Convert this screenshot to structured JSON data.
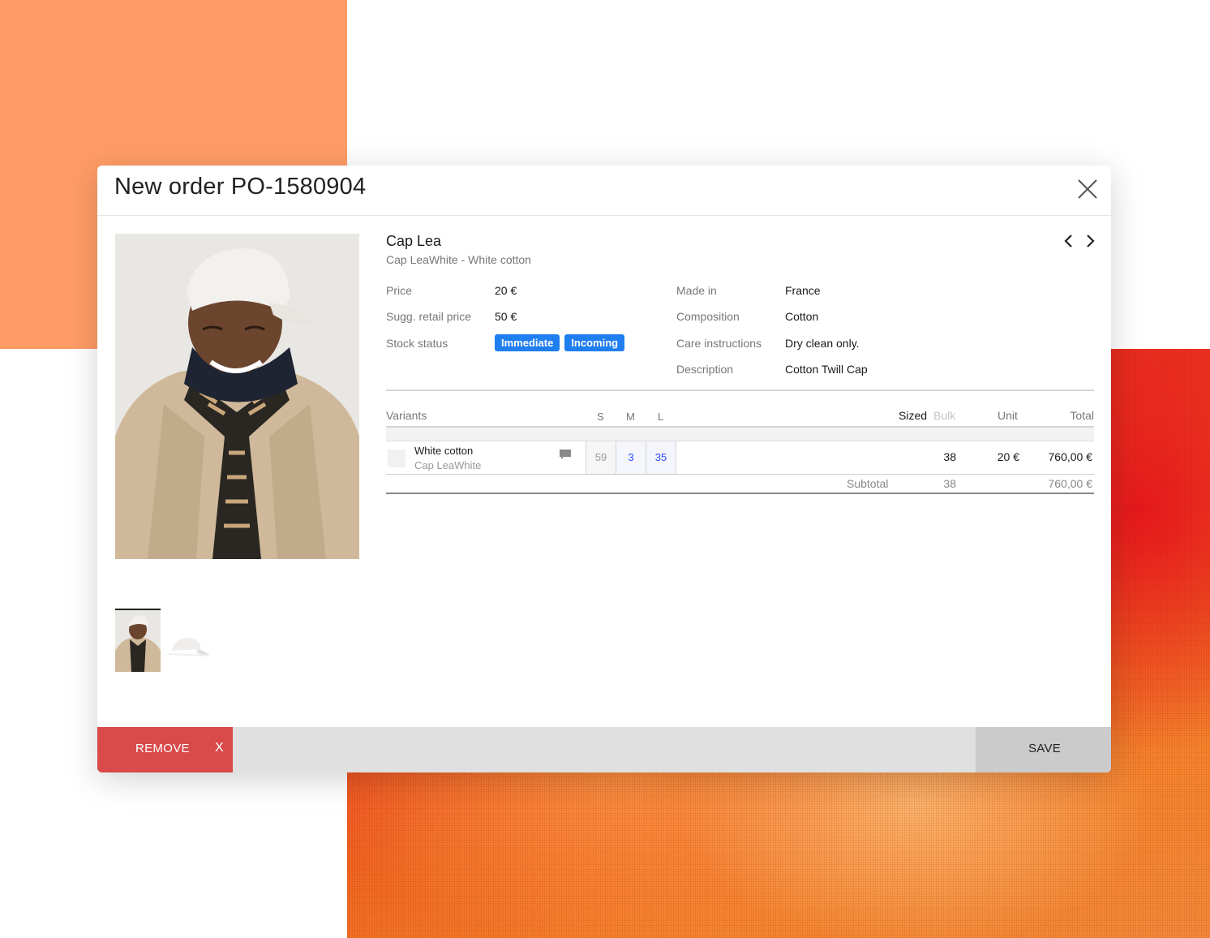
{
  "modal": {
    "title": "New order PO-1580904",
    "close_icon": "close-icon"
  },
  "product": {
    "name": "Cap Lea",
    "subtitle": "Cap LeaWhite - White cotton",
    "nav": {
      "prev_icon": "chevron-left-icon",
      "next_icon": "chevron-right-icon"
    }
  },
  "attributes_left": [
    {
      "label": "Price",
      "value": "20 €"
    },
    {
      "label": "Sugg. retail price",
      "value": "50 €"
    },
    {
      "label": "Stock status",
      "badges": [
        "Immediate",
        "Incoming"
      ]
    }
  ],
  "attributes_right": [
    {
      "label": "Made in",
      "value": "France"
    },
    {
      "label": "Composition",
      "value": "Cotton"
    },
    {
      "label": "Care instructions",
      "value": "Dry clean only."
    },
    {
      "label": "Description",
      "value": "Cotton Twill Cap"
    }
  ],
  "variants_table": {
    "headers": {
      "variants": "Variants",
      "sizes": [
        "S",
        "M",
        "L"
      ],
      "sized": "Sized",
      "bulk": "Bulk",
      "unit": "Unit",
      "total": "Total"
    },
    "rows": [
      {
        "name": "White cotton",
        "sub": "Cap LeaWhite",
        "quantities": [
          "59",
          "3",
          "35"
        ],
        "sized": "38",
        "unit": "20 €",
        "total": "760,00 €"
      }
    ],
    "subtotal": {
      "label": "Subtotal",
      "sized": "38",
      "total": "760,00 €"
    }
  },
  "footer": {
    "remove_label": "REMOVE",
    "remove_x": "X",
    "save_label": "SAVE"
  },
  "colors": {
    "badge_blue": "#1f7ef0",
    "remove_red": "#d94a4a",
    "qty_blue": "#2e4cff",
    "bg_orange": "#ff9c66"
  }
}
